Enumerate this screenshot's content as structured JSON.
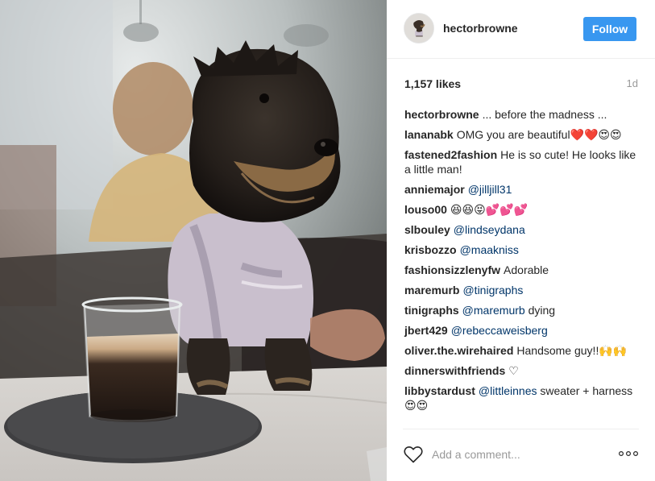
{
  "post": {
    "username": "hectorbrowne",
    "follow_label": "Follow",
    "likes": "1,157 likes",
    "age": "1d"
  },
  "comments": [
    {
      "user": "hectorbrowne",
      "text": "... before the madness ..."
    },
    {
      "user": "lananabk",
      "text": "OMG you are beautiful❤️❤️😍😍"
    },
    {
      "user": "fastened2fashion",
      "text": "He is so cute! He looks like a little man!"
    },
    {
      "user": "anniemajor",
      "mention": "@jilljill31",
      "text": ""
    },
    {
      "user": "louso00",
      "text": "😆😆😝💕💕💕"
    },
    {
      "user": "slbouley",
      "mention": "@lindseydana",
      "text": ""
    },
    {
      "user": "krisbozzo",
      "mention": "@maakniss",
      "text": ""
    },
    {
      "user": "fashionsizzlenyfw",
      "text": "Adorable"
    },
    {
      "user": "maremurb",
      "mention": "@tinigraphs",
      "text": ""
    },
    {
      "user": "tinigraphs",
      "mention": "@maremurb",
      "text": "dying"
    },
    {
      "user": "jbert429",
      "mention": "@rebeccaweisberg",
      "text": ""
    },
    {
      "user": "oliver.the.wirehaired",
      "text": "Handsome guy!!🙌🙌"
    },
    {
      "user": "dinnerswithfriends",
      "text": "♡"
    },
    {
      "user": "libbystardust",
      "mention": "@littleinnes",
      "text": "sweater + harness 😍😍"
    }
  ],
  "footer": {
    "add_comment_placeholder": "Add a comment...",
    "heart_icon": "heart-outline-icon",
    "more_icon": "more-options-icon"
  },
  "colors": {
    "follow_button": "#3897f0",
    "mention": "#003569",
    "meta_text": "#999999"
  }
}
